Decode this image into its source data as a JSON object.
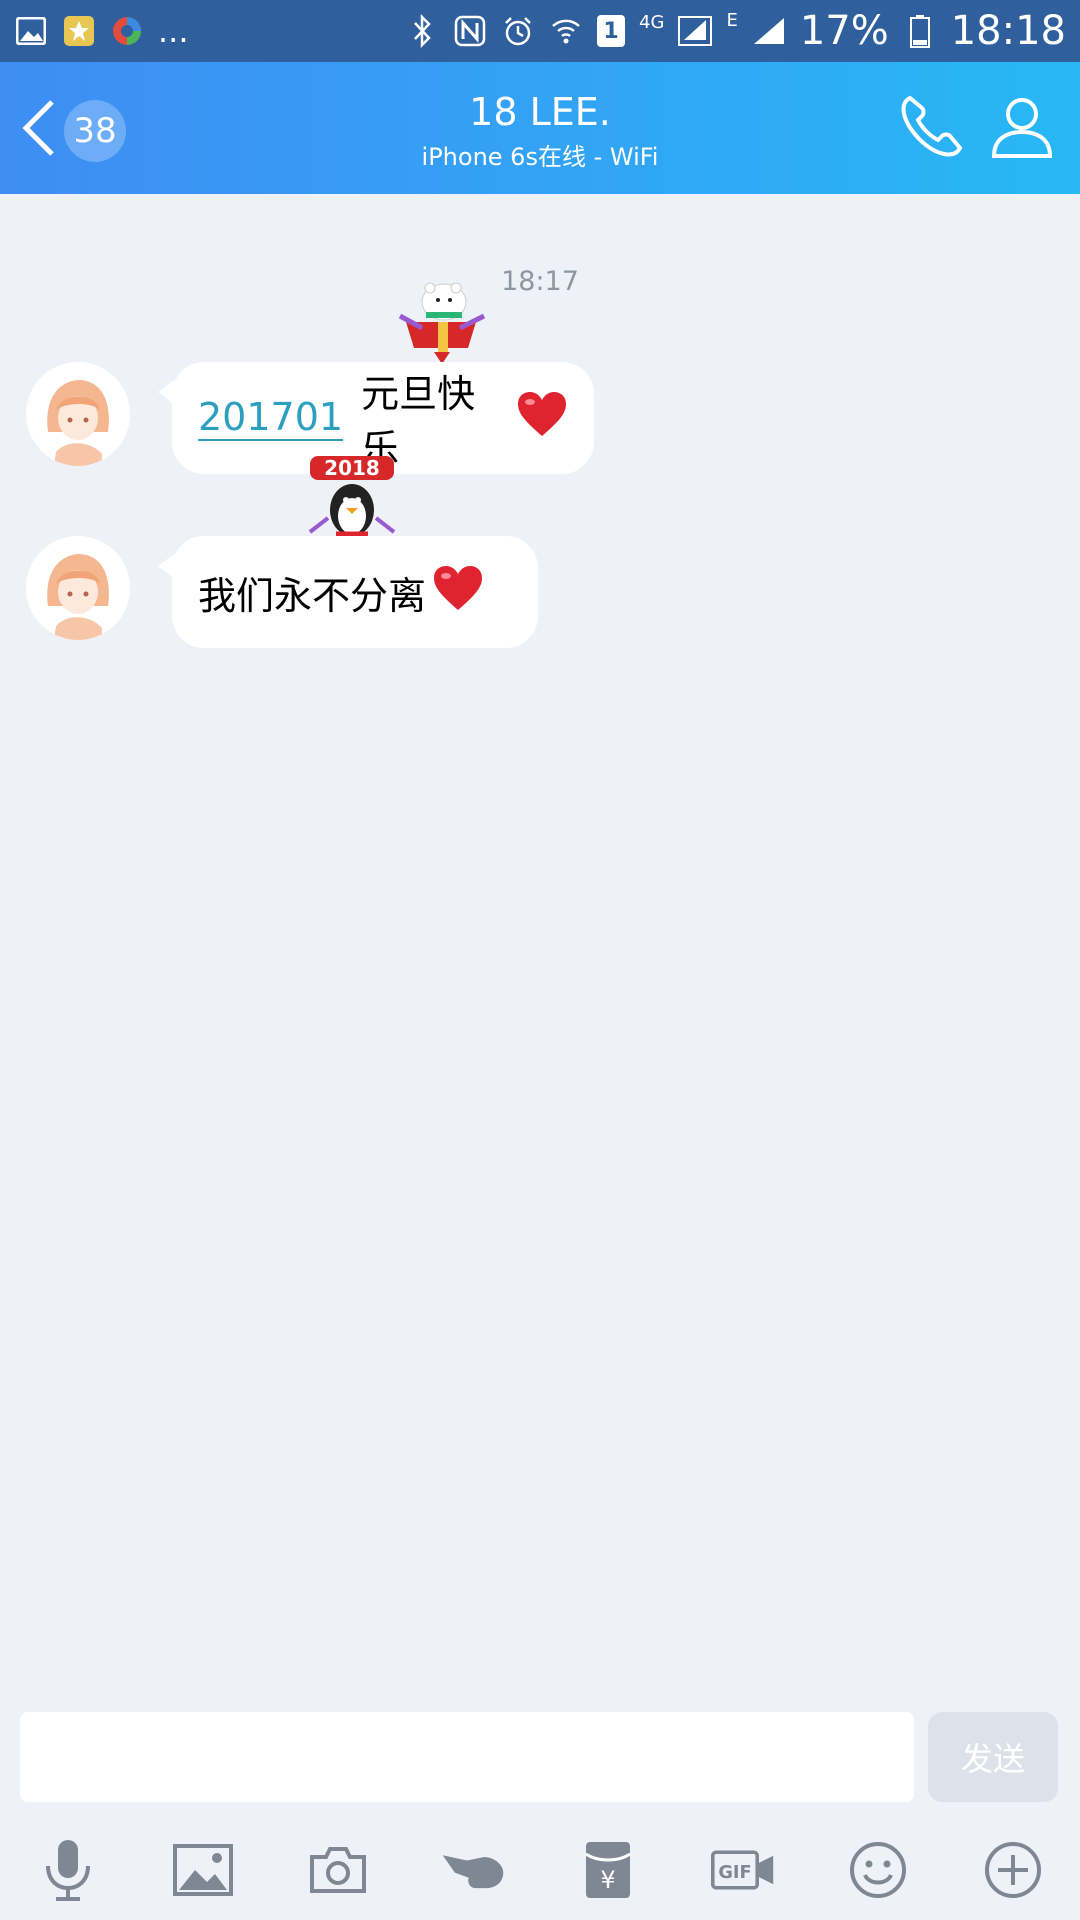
{
  "status_bar": {
    "left_overflow": "...",
    "network_4g": "4G",
    "sim_slot": "1",
    "network_e": "E",
    "battery": "17%",
    "time": "18:18"
  },
  "header": {
    "unread_count": "38",
    "title": "18 LEE.",
    "subtitle": "iPhone 6s在线 - WiFi"
  },
  "chat": {
    "timestamp": "18:17",
    "messages": [
      {
        "link": "201701",
        "text": "元旦快乐",
        "emoji": "heart-emoji",
        "sticker": "gift-polar-bear-sticker"
      },
      {
        "text": "我们永不分离",
        "emoji": "heart-emoji",
        "sticker": "penguin-2018-sticker"
      }
    ]
  },
  "input": {
    "value": "",
    "send_label": "发送"
  },
  "toolbar": {
    "icons": [
      "microphone-icon",
      "image-icon",
      "camera-icon",
      "poke-icon",
      "red-packet-icon",
      "gif-icon",
      "emoji-icon",
      "plus-icon"
    ]
  }
}
